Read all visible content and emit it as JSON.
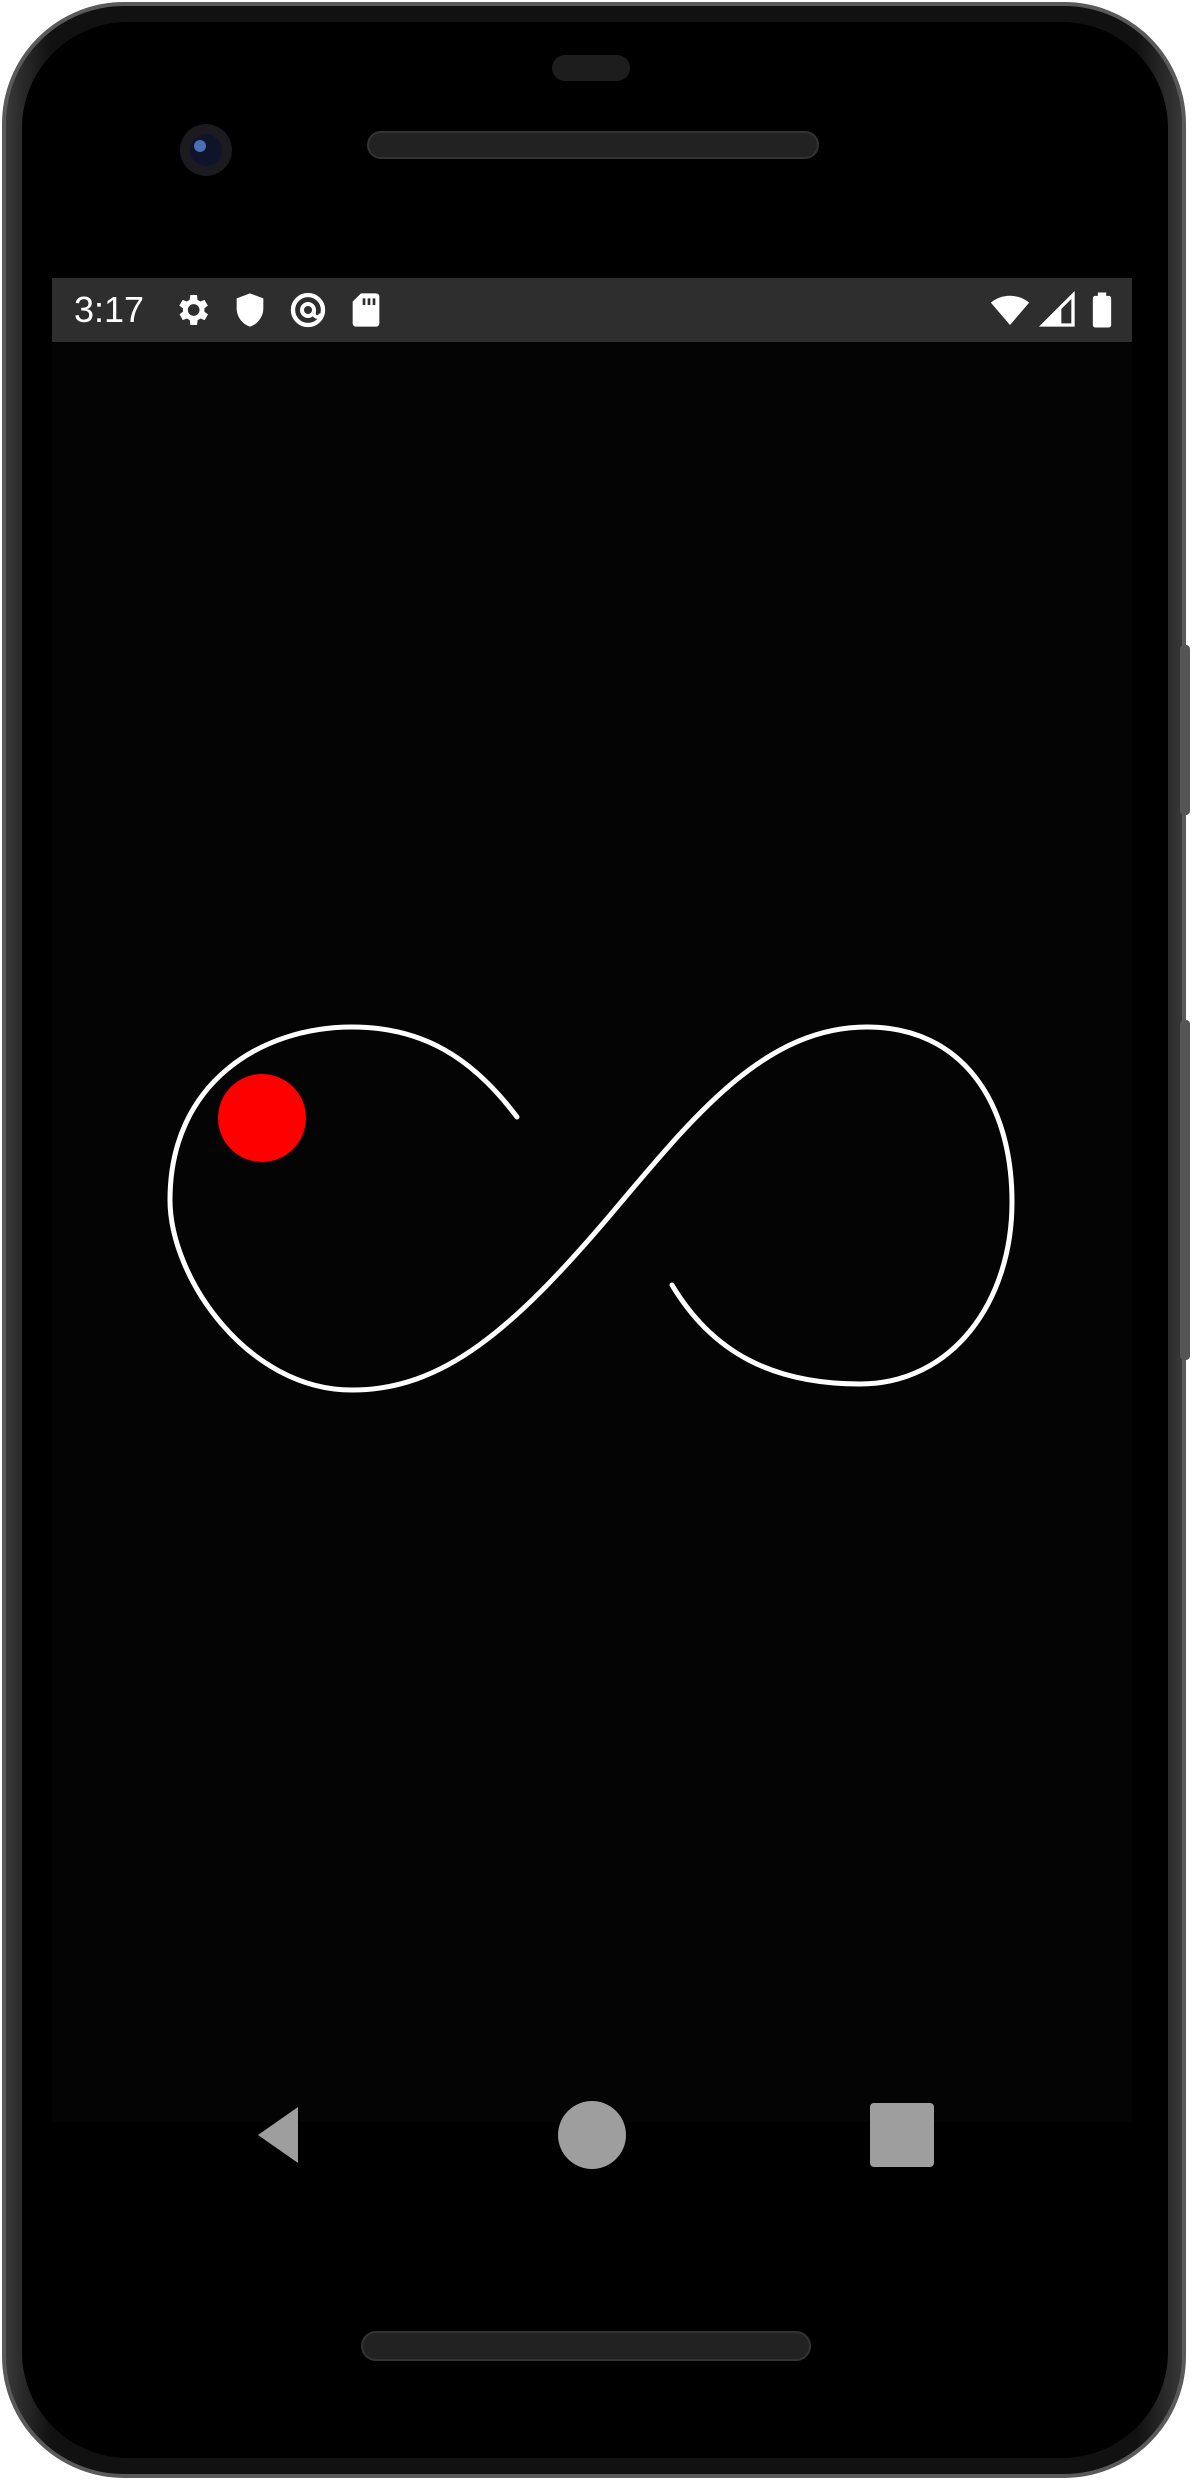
{
  "status_bar": {
    "time": "3:17",
    "left_icons": [
      "gear-icon",
      "shield-icon",
      "at-sign-icon",
      "sd-card-icon"
    ],
    "right_icons": [
      "wifi-icon",
      "cellular-signal-icon",
      "battery-icon"
    ],
    "background": "#2e2e2e",
    "foreground": "#ffffff"
  },
  "app": {
    "background": "#040404",
    "path_color": "#ffffff",
    "ball_color": "#ff0000",
    "path_shape": "infinity-loop"
  },
  "nav_bar": {
    "buttons": [
      "back-icon",
      "home-icon",
      "recents-icon"
    ],
    "button_color": "#9e9e9e"
  },
  "device": {
    "frame_color": "#1a1a1a",
    "screen_color": "#000000"
  }
}
